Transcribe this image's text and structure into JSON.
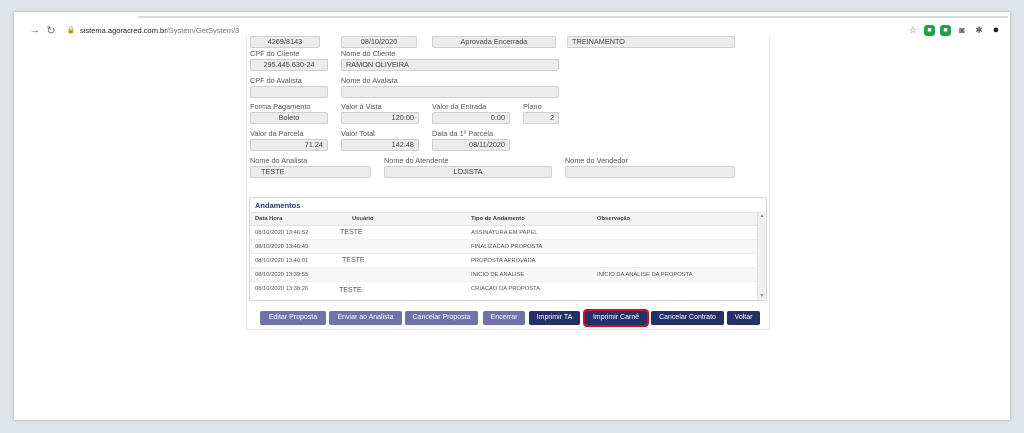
{
  "browser": {
    "url_host": "sistema.agoracred.com.br",
    "url_path": "/System/GetSystem/3",
    "back_icon": "arrow-left-icon",
    "reload_icon": "reload-icon"
  },
  "top_row": {
    "field1": "4269/8143",
    "field2": "08/10/2020",
    "field3": "Aprovada Encerrada",
    "field4": "TREINAMENTO"
  },
  "cliente": {
    "cpf_label": "CPF do Cliente",
    "cpf_value": "295.445.630-24",
    "nome_label": "Nome do Cliente",
    "nome_value": "RAMON OLIVEIRA"
  },
  "avalista": {
    "cpf_label": "CPF do Avalista",
    "cpf_value": "",
    "nome_label": "Nome do Avalista",
    "nome_value": ""
  },
  "pagamento": {
    "forma_label": "Forma Pagamento",
    "forma_value": "Boleto",
    "vista_label": "Valor à Vista",
    "vista_value": "120.00",
    "entrada_label": "Valor da Entrada",
    "entrada_value": "0.00",
    "plano_label": "Plano",
    "plano_value": "2"
  },
  "parcela": {
    "valor_label": "Valor da Parcela",
    "valor_value": "71.24",
    "total_label": "Valor Total",
    "total_value": "142.48",
    "data_label": "Data da 1º Parcela",
    "data_value": "08/11/2020"
  },
  "equipe": {
    "analista_label": "Nome do Analista",
    "analista_value": "TESTE",
    "atendente_label": "Nome do Atendente",
    "atendente_value": "LOJISTA",
    "vendedor_label": "Nome do Vendedor",
    "vendedor_value": ""
  },
  "andamentos": {
    "title": "Andamentos",
    "headers": {
      "data_hora": "Data Hora",
      "usuario": "Usuário",
      "tipo": "Tipo de Andamento",
      "obs": "Observação"
    },
    "rows": [
      {
        "data_hora": "08/10/2020 13:46:52",
        "usuario": "TESTE",
        "tipo": "ASSINATURA EM PAPEL",
        "obs": ""
      },
      {
        "data_hora": "08/10/2020 13:46:49",
        "usuario": "",
        "tipo": "FINALIZACAO PROPOSTA",
        "obs": ""
      },
      {
        "data_hora": "08/10/2020 13:40:01",
        "usuario": "TESTE",
        "tipo": "PROPOSTA APROVADA",
        "obs": ""
      },
      {
        "data_hora": "08/10/2020 13:39:55",
        "usuario": "",
        "tipo": "INICIO DE ANALISE",
        "obs": "INÍCIO DA ANÁLISE DA PROPOSTA"
      },
      {
        "data_hora": "08/10/2020 13:38:26",
        "usuario": "TESTE",
        "tipo": "CRIACAO DA PROPOSTA",
        "obs": ""
      }
    ]
  },
  "buttons": {
    "editar": "Editar Proposta",
    "enviar": "Enviar ao Analista",
    "cancelar_proposta": "Cancelar Proposta",
    "encerrar": "Encerrar",
    "imprimir_ta": "Imprimir TA",
    "imprimir_carne": "Imprimir Carnê",
    "cancelar_contrato": "Cancelar Contrato",
    "voltar": "Voltar"
  },
  "colors": {
    "button_light": "#7272a8",
    "button_dark": "#263068",
    "highlight": "#d40e1e"
  }
}
